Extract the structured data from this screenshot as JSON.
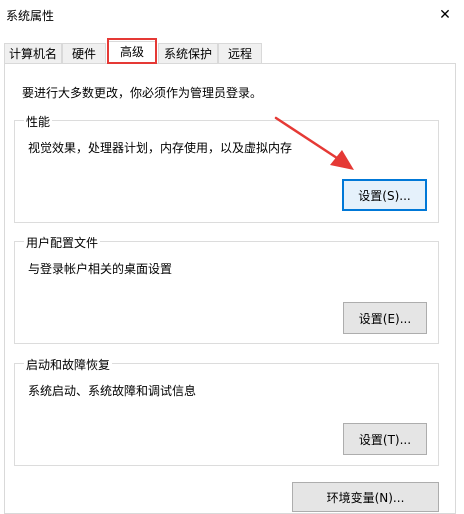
{
  "window": {
    "title": "系统属性",
    "close_glyph": "✕"
  },
  "tabs": [
    {
      "label": "计算机名",
      "active": false
    },
    {
      "label": "硬件",
      "active": false
    },
    {
      "label": "高级",
      "active": true
    },
    {
      "label": "系统保护",
      "active": false
    },
    {
      "label": "远程",
      "active": false
    }
  ],
  "admin_note": "要进行大多数更改，你必须作为管理员登录。",
  "performance": {
    "title": "性能",
    "description": "视觉效果，处理器计划，内存使用，以及虚拟内存",
    "button": "设置(S)..."
  },
  "user_profiles": {
    "title": "用户配置文件",
    "description": "与登录帐户相关的桌面设置",
    "button": "设置(E)..."
  },
  "startup_recovery": {
    "title": "启动和故障恢复",
    "description": "系统启动、系统故障和调试信息",
    "button": "设置(T)..."
  },
  "env_button": "环境变量(N)...",
  "colors": {
    "highlight": "#e53935",
    "focus_border": "#0078d7"
  }
}
